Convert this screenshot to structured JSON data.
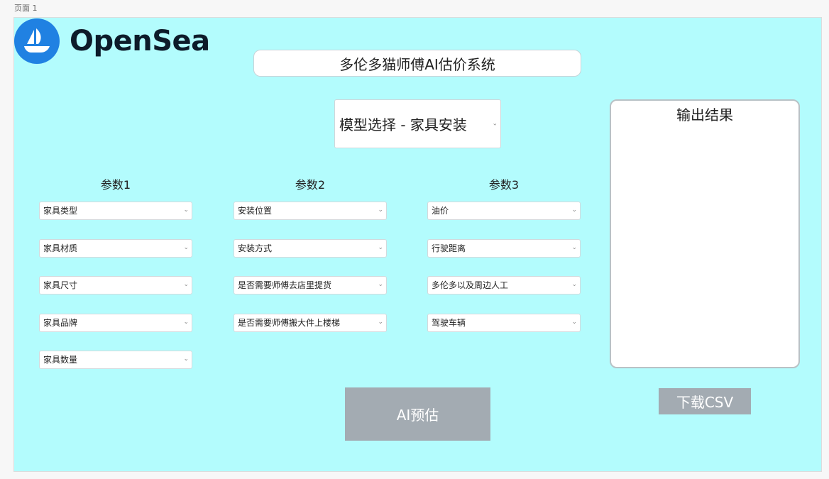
{
  "page": {
    "label": "页面 1"
  },
  "brand": {
    "name": "OpenSea",
    "icon": "opensea-sailboat-icon",
    "color": "#2081e2"
  },
  "header": {
    "title": "多伦多猫师傅AI估价系统"
  },
  "model_select": {
    "value": "模型选择 - 家具安装"
  },
  "params": [
    {
      "heading": "参数1",
      "selects": [
        "家具类型",
        "家具材质",
        "家具尺寸",
        "家具品牌",
        "家具数量"
      ]
    },
    {
      "heading": "参数2",
      "selects": [
        "安装位置",
        "安装方式",
        "是否需要师傅去店里提货",
        "是否需要师傅搬大件上楼梯"
      ]
    },
    {
      "heading": "参数3",
      "selects": [
        "油价",
        "行驶距离",
        "多伦多以及周边人工",
        "驾驶车辆"
      ]
    }
  ],
  "output": {
    "title": "输出结果"
  },
  "actions": {
    "predict_label": "AI预估",
    "download_label": "下载CSV"
  },
  "colors": {
    "canvas_bg": "#b3fcfd",
    "button_bg": "#a3abb2"
  }
}
